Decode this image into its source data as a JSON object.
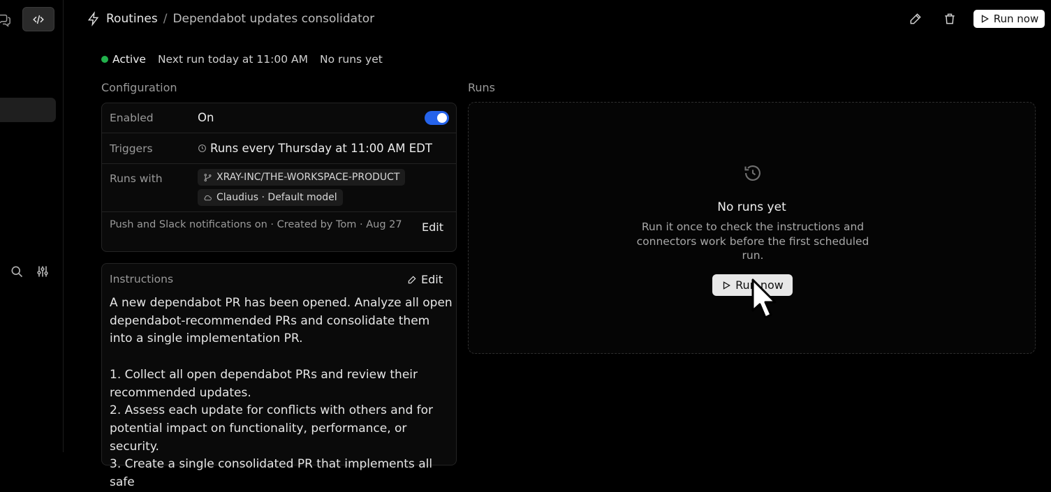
{
  "header": {
    "section": "Routines",
    "separator": "/",
    "current": "Dependabot updates consolidator",
    "run_now_label": "Run now"
  },
  "status": {
    "state": "Active",
    "next_run": "Next run today at 11:00 AM",
    "runs_summary": "No runs yet",
    "state_color": "#22b14c"
  },
  "configuration": {
    "title": "Configuration",
    "enabled_label": "Enabled",
    "enabled_value": "On",
    "enabled": true,
    "triggers_label": "Triggers",
    "triggers_value": "Runs every Thursday at 11:00 AM EDT",
    "runs_with_label": "Runs with",
    "repo_chip": "XRAY-INC/THE-WORKSPACE-PRODUCT",
    "model_chip": "Claudius · Default model",
    "notifications": "Push and Slack notifications on · Created by Tom · Aug 27",
    "edit_label": "Edit"
  },
  "instructions": {
    "title": "Instructions",
    "edit_label": "Edit",
    "intro": "A new dependabot PR has been opened. Analyze all open dependabot-recommended PRs and consolidate them into a single implementation PR.",
    "step1": "1. Collect all open dependabot PRs and review their recommended updates.",
    "step2": "2. Assess each update for conflicts with others and for potential impact on functionality, performance, or security.",
    "step3": "3. Create a single consolidated PR that implements all safe"
  },
  "runs": {
    "title": "Runs",
    "empty_title": "No runs yet",
    "empty_desc": "Run it once to check the instructions and connectors work before the first scheduled run.",
    "run_now_label": "Run now"
  },
  "colors": {
    "accent": "#2563eb",
    "background": "#000000"
  }
}
